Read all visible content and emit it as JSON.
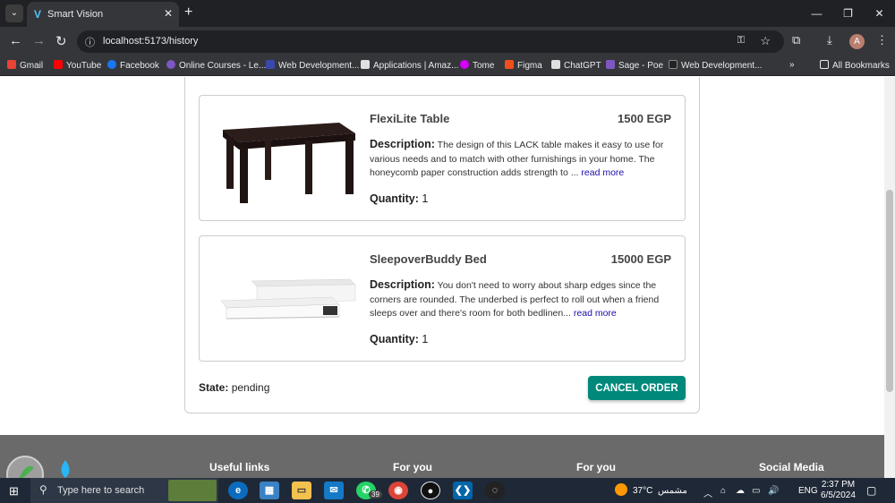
{
  "browser": {
    "tab_title": "Smart Vision",
    "tab_favicon": "V",
    "url": "localhost:5173/history",
    "avatar_letter": "A",
    "bookmarks": [
      {
        "label": "Gmail",
        "color": "#ea4335"
      },
      {
        "label": "YouTube",
        "color": "#ff0000"
      },
      {
        "label": "Facebook",
        "color": "#1877f2"
      },
      {
        "label": "Online Courses - Le...",
        "color": "#7e57c2"
      },
      {
        "label": "Web Development...",
        "color": "#3949ab"
      },
      {
        "label": "Applications | Amaz...",
        "color": "#e0e0e0"
      },
      {
        "label": "Tome",
        "color": "#d500f9"
      },
      {
        "label": "Figma",
        "color": "#f24e1e"
      },
      {
        "label": "ChatGPT",
        "color": "#e0e0e0"
      },
      {
        "label": "Sage - Poe",
        "color": "#7e57c2"
      },
      {
        "label": "Web Development...",
        "color": "#222222"
      }
    ],
    "all_bookmarks_label": "All Bookmarks"
  },
  "order": {
    "items": [
      {
        "name": "FlexiLite Table",
        "price": "1500 EGP",
        "description_label": "Description:",
        "description": "The design of this LACK table makes it easy to use for various needs and to match with other furnishings in your home. The honeycomb paper construction adds strength to ...",
        "read_more": "read more",
        "quantity_label": "Quantity:",
        "quantity": "1"
      },
      {
        "name": "SleepoverBuddy Bed",
        "price": "15000 EGP",
        "description_label": "Description:",
        "description": "You don't need to worry about sharp edges since the corners are rounded. The underbed is perfect to roll out when a friend sleeps over and there's room for both bedlinen...",
        "read_more": "read more",
        "quantity_label": "Quantity:",
        "quantity": "1"
      }
    ],
    "state_label": "State:",
    "state": "pending",
    "cancel_label": "CANCEL ORDER",
    "accent": "#00897b"
  },
  "footer": {
    "headings": [
      "Useful links",
      "For you",
      "For you",
      "Social Media"
    ]
  },
  "taskbar": {
    "search_placeholder": "Type here to search",
    "whatsapp_badge": "39",
    "weather": "37°C",
    "weather_desc": "مشمس",
    "lang": "ENG",
    "time": "2:37 PM",
    "date": "6/5/2024"
  }
}
